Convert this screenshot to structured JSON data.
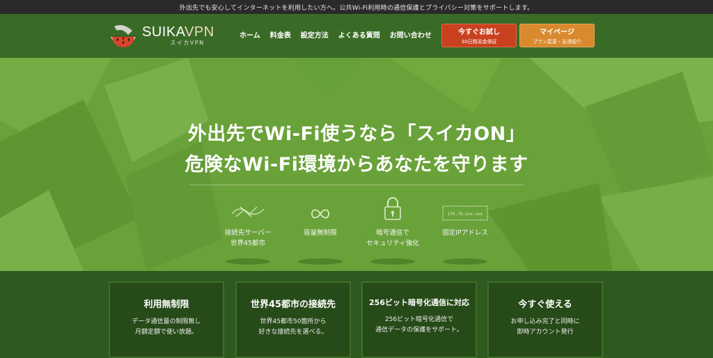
{
  "topbar": {
    "text": "外出先でも安心してインターネットを利用したい方へ。公共Wi-Fi利用時の通信保護とプライバシー対策をサポートします。"
  },
  "logo": {
    "main": "SUIKA",
    "accent": "VPN",
    "sub": "スイカVPN",
    "icon": "watermelon-icon"
  },
  "nav": {
    "items": [
      "ホーム",
      "料金表",
      "設定方法",
      "よくある質問",
      "お問い合わせ"
    ]
  },
  "buttons": {
    "trial": {
      "line1": "今すぐお試し",
      "line2": "30日間返金保証",
      "color": "#c9411f"
    },
    "mypage": {
      "line1": "マイページ",
      "line2": "プラン変更・友達紹介",
      "color": "#d98a2e"
    }
  },
  "hero": {
    "title_line1": "外出先でWi-Fi使うなら「スイカON」",
    "title_line2": "危険なWi-Fi環境からあなたを守ります",
    "features": [
      {
        "icon": "network-icon",
        "label1": "接続先サーバー",
        "label2": "世界45都市"
      },
      {
        "icon": "infinity-icon",
        "label1": "容量無制限",
        "label2": ""
      },
      {
        "icon": "lock-icon",
        "label1": "暗号通信で",
        "label2": "セキュリティ強化"
      },
      {
        "icon": "ip-address-icon",
        "label1": "固定IPアドレス",
        "label2": "",
        "icon_text": "170.76.xxx.xxx"
      }
    ]
  },
  "cards": [
    {
      "title": "利用無制限",
      "line1": "データ通信量の制限無し",
      "line2": "月額定額で使い放題。"
    },
    {
      "title": "世界45都市の接続先",
      "line1": "世界45都市50箇所から",
      "line2": "好きな接続先を選べる。"
    },
    {
      "title": "256ビット暗号化通信に対応",
      "line1": "256ビット暗号化通信で",
      "line2": "通信データの保護をサポート。"
    },
    {
      "title": "今すぐ使える",
      "line1": "お申し込み完了と同時に",
      "line2": "即時アカウント発行"
    }
  ],
  "colors": {
    "header": "#3a6b26",
    "hero": "#6aa23a",
    "bottom": "#2f5a1f"
  }
}
